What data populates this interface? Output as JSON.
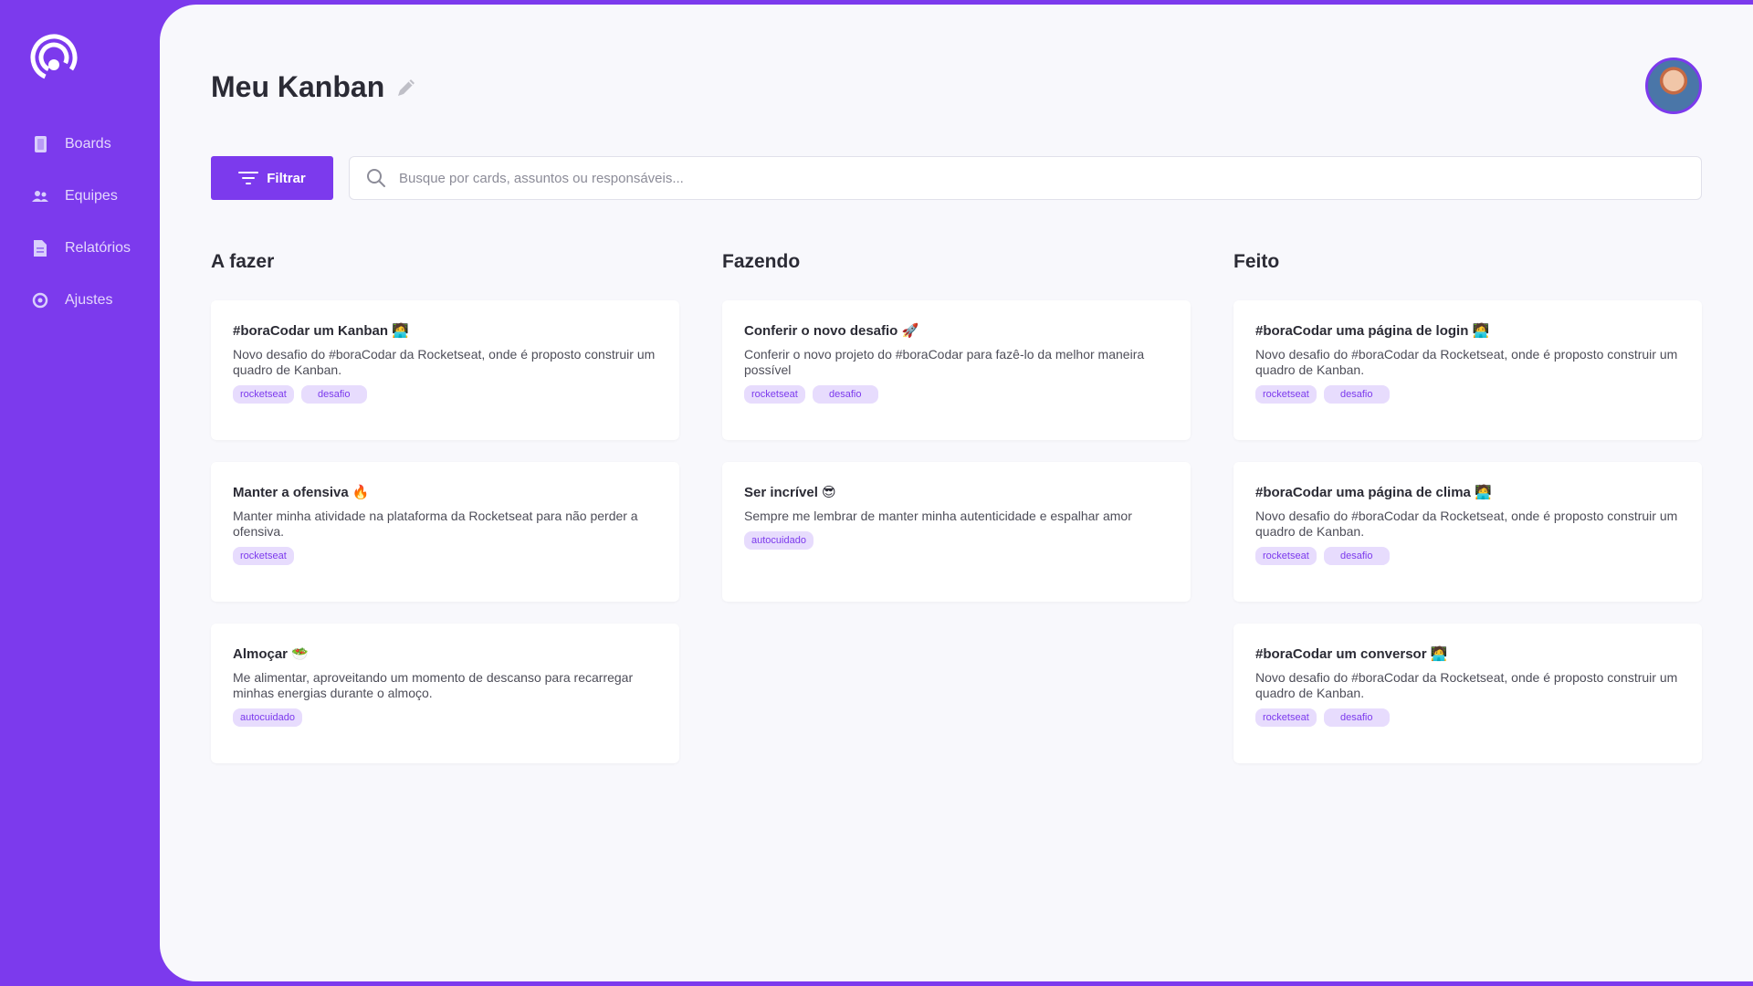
{
  "sidebar": {
    "items": [
      {
        "label": "Boards",
        "icon": "boards-icon"
      },
      {
        "label": "Equipes",
        "icon": "team-icon"
      },
      {
        "label": "Relatórios",
        "icon": "report-icon"
      },
      {
        "label": "Ajustes",
        "icon": "settings-icon"
      }
    ]
  },
  "header": {
    "title": "Meu Kanban"
  },
  "toolbar": {
    "filter_label": "Filtrar"
  },
  "search": {
    "placeholder": "Busque por cards, assuntos ou responsáveis..."
  },
  "columns": [
    {
      "title": "A fazer",
      "cards": [
        {
          "title": "#boraCodar um Kanban 🧑‍💻",
          "description": "Novo desafio do #boraCodar da Rocketseat, onde é proposto construir um quadro de Kanban.",
          "tags": [
            "rocketseat",
            "desafio"
          ]
        },
        {
          "title": "Manter a ofensiva 🔥",
          "description": "Manter minha atividade na plataforma da Rocketseat para não perder a ofensiva.",
          "tags": [
            "rocketseat"
          ]
        },
        {
          "title": "Almoçar 🥗",
          "description": "Me alimentar, aproveitando um momento de descanso para recarregar minhas energias durante o almoço.",
          "tags": [
            "autocuidado"
          ]
        }
      ]
    },
    {
      "title": "Fazendo",
      "cards": [
        {
          "title": "Conferir o novo desafio 🚀",
          "description": "Conferir o novo projeto do #boraCodar para fazê-lo da melhor maneira possível",
          "tags": [
            "rocketseat",
            "desafio"
          ]
        },
        {
          "title": "Ser incrível 😎",
          "description": "Sempre me lembrar de manter minha autenticidade e espalhar amor",
          "tags": [
            "autocuidado"
          ]
        }
      ]
    },
    {
      "title": "Feito",
      "cards": [
        {
          "title": "#boraCodar uma página de login 🧑‍💻",
          "description": "Novo desafio do #boraCodar da Rocketseat, onde é proposto construir um quadro de Kanban.",
          "tags": [
            "rocketseat",
            "desafio"
          ]
        },
        {
          "title": "#boraCodar uma página de clima 🧑‍💻",
          "description": "Novo desafio do #boraCodar da Rocketseat, onde é proposto construir um quadro de Kanban.",
          "tags": [
            "rocketseat",
            "desafio"
          ]
        },
        {
          "title": "#boraCodar um conversor 🧑‍💻",
          "description": "Novo desafio do #boraCodar da Rocketseat, onde é proposto construir um quadro de Kanban.",
          "tags": [
            "rocketseat",
            "desafio"
          ]
        }
      ]
    }
  ],
  "colors": {
    "accent": "#7c3aed",
    "tag_bg": "#e7dcfd",
    "background": "#f8f8fc"
  }
}
